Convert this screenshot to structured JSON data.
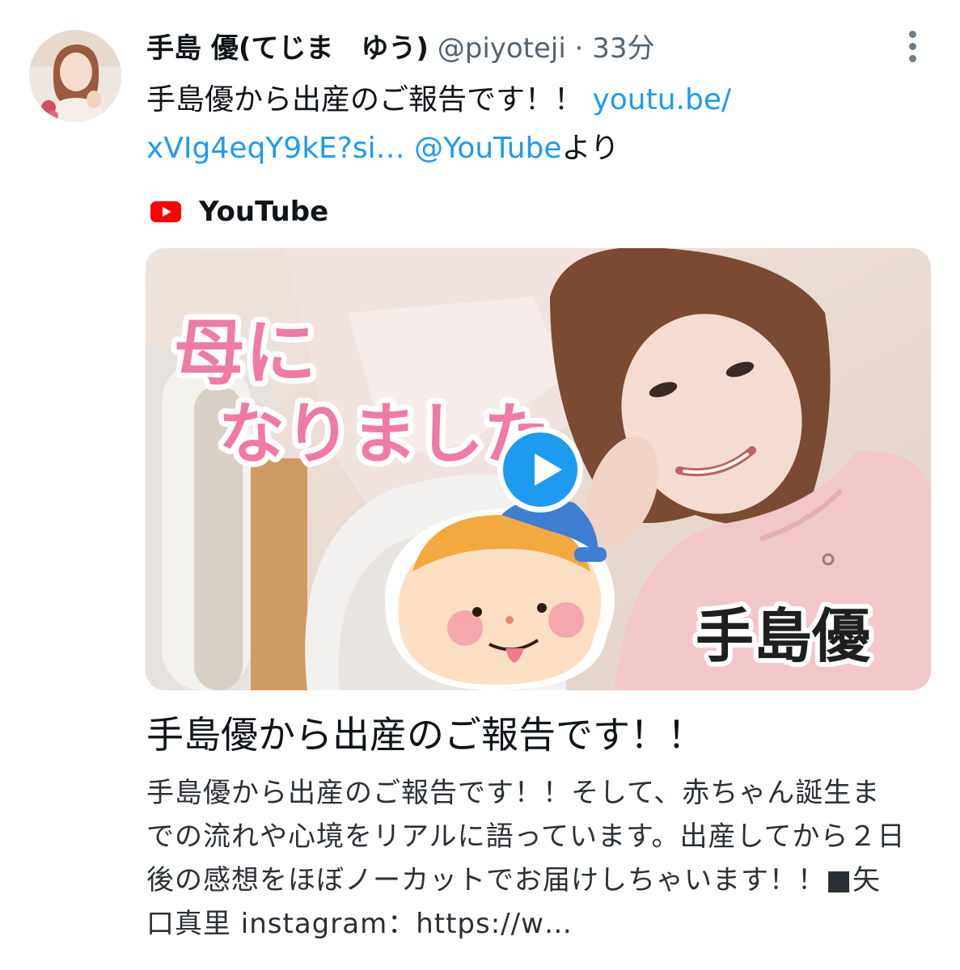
{
  "tweet": {
    "author_name": "手島 優(てじま　ゆう)",
    "handle": "@piyoteji",
    "separator": "·",
    "time": "33分",
    "text_prefix": "手島優から出産のご報告です！！ ",
    "link_text": "youtu.be/​xVIg4eqY9kE?si…",
    "mention": "@YouTube",
    "text_suffix": "より"
  },
  "card": {
    "source": "YouTube",
    "thumbnail_caption_line1": "母に",
    "thumbnail_caption_line2": "なりました",
    "thumbnail_name": "手島優",
    "title": "手島優から出産のご報告です！！",
    "description": "手島優から出産のご報告です！！そして、赤ちゃん誕生までの流れや心境をリアルに語っています。出産してから２日後の感想をほぼノーカットでお届けしちゃいます！！■矢口真里 instagram：https://w…"
  },
  "icons": {
    "more": "more-vertical-icon",
    "source": "youtube-logo-icon",
    "play": "play-icon"
  },
  "colors": {
    "link": "#1d9bf0",
    "text": "#0f1419",
    "secondary": "#536471",
    "caption_pink": "#f07aa6",
    "youtube_red": "#ff0000"
  }
}
